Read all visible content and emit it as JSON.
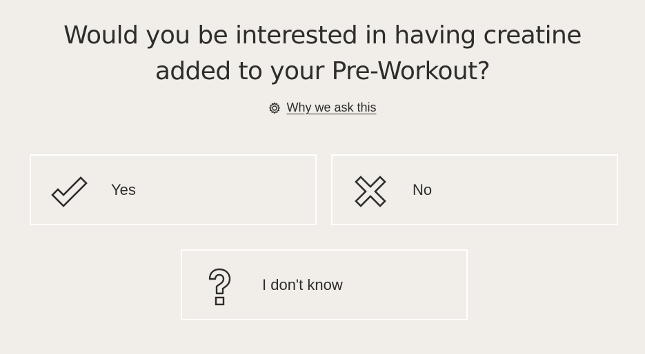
{
  "question": {
    "line1": "Would you be interested in having creatine",
    "line2": "added to your Pre-Workout?"
  },
  "why_link": {
    "icon": "gear-icon",
    "label": "Why we ask this"
  },
  "options": [
    {
      "label": "Yes",
      "icon": "checkmark-icon"
    },
    {
      "label": "No",
      "icon": "x-icon"
    },
    {
      "label": "I don't know",
      "icon": "question-mark-icon"
    }
  ],
  "colors": {
    "background": "#f1ede8",
    "text": "#2d2d2b",
    "option_border": "#ffffff"
  }
}
